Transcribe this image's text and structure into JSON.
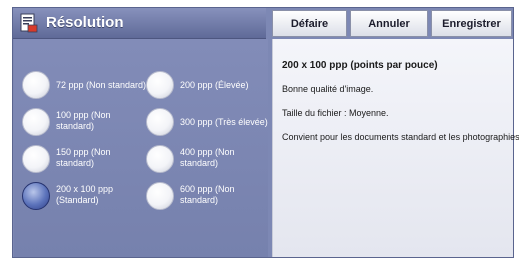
{
  "header": {
    "title": "Résolution",
    "icon": "document-scan-icon"
  },
  "toolbar": {
    "undo_label": "Défaire",
    "cancel_label": "Annuler",
    "save_label": "Enregistrer"
  },
  "options": {
    "opt_72": "72 ppp (Non standard)",
    "opt_100": "100 ppp (Non standard)",
    "opt_150": "150 ppp (Non standard)",
    "opt_200x100": "200 x 100 ppp (Standard)",
    "opt_200": "200 ppp (Élevée)",
    "opt_300": "300 ppp (Très élevée)",
    "opt_400": "400 ppp (Non standard)",
    "opt_600": "600 ppp (Non standard)",
    "selected": "200 x 100 ppp (Standard)"
  },
  "info": {
    "title": "200 x 100 ppp (points par pouce)",
    "quality": "Bonne qualité d'image.",
    "file_size": "Taille du fichier : Moyenne.",
    "usage": "Convient pour les documents standard et les photographies."
  },
  "colors": {
    "panel": "#7d88b4",
    "selected_radio": "#2f3f88",
    "info_background": "#f0f1f7"
  }
}
